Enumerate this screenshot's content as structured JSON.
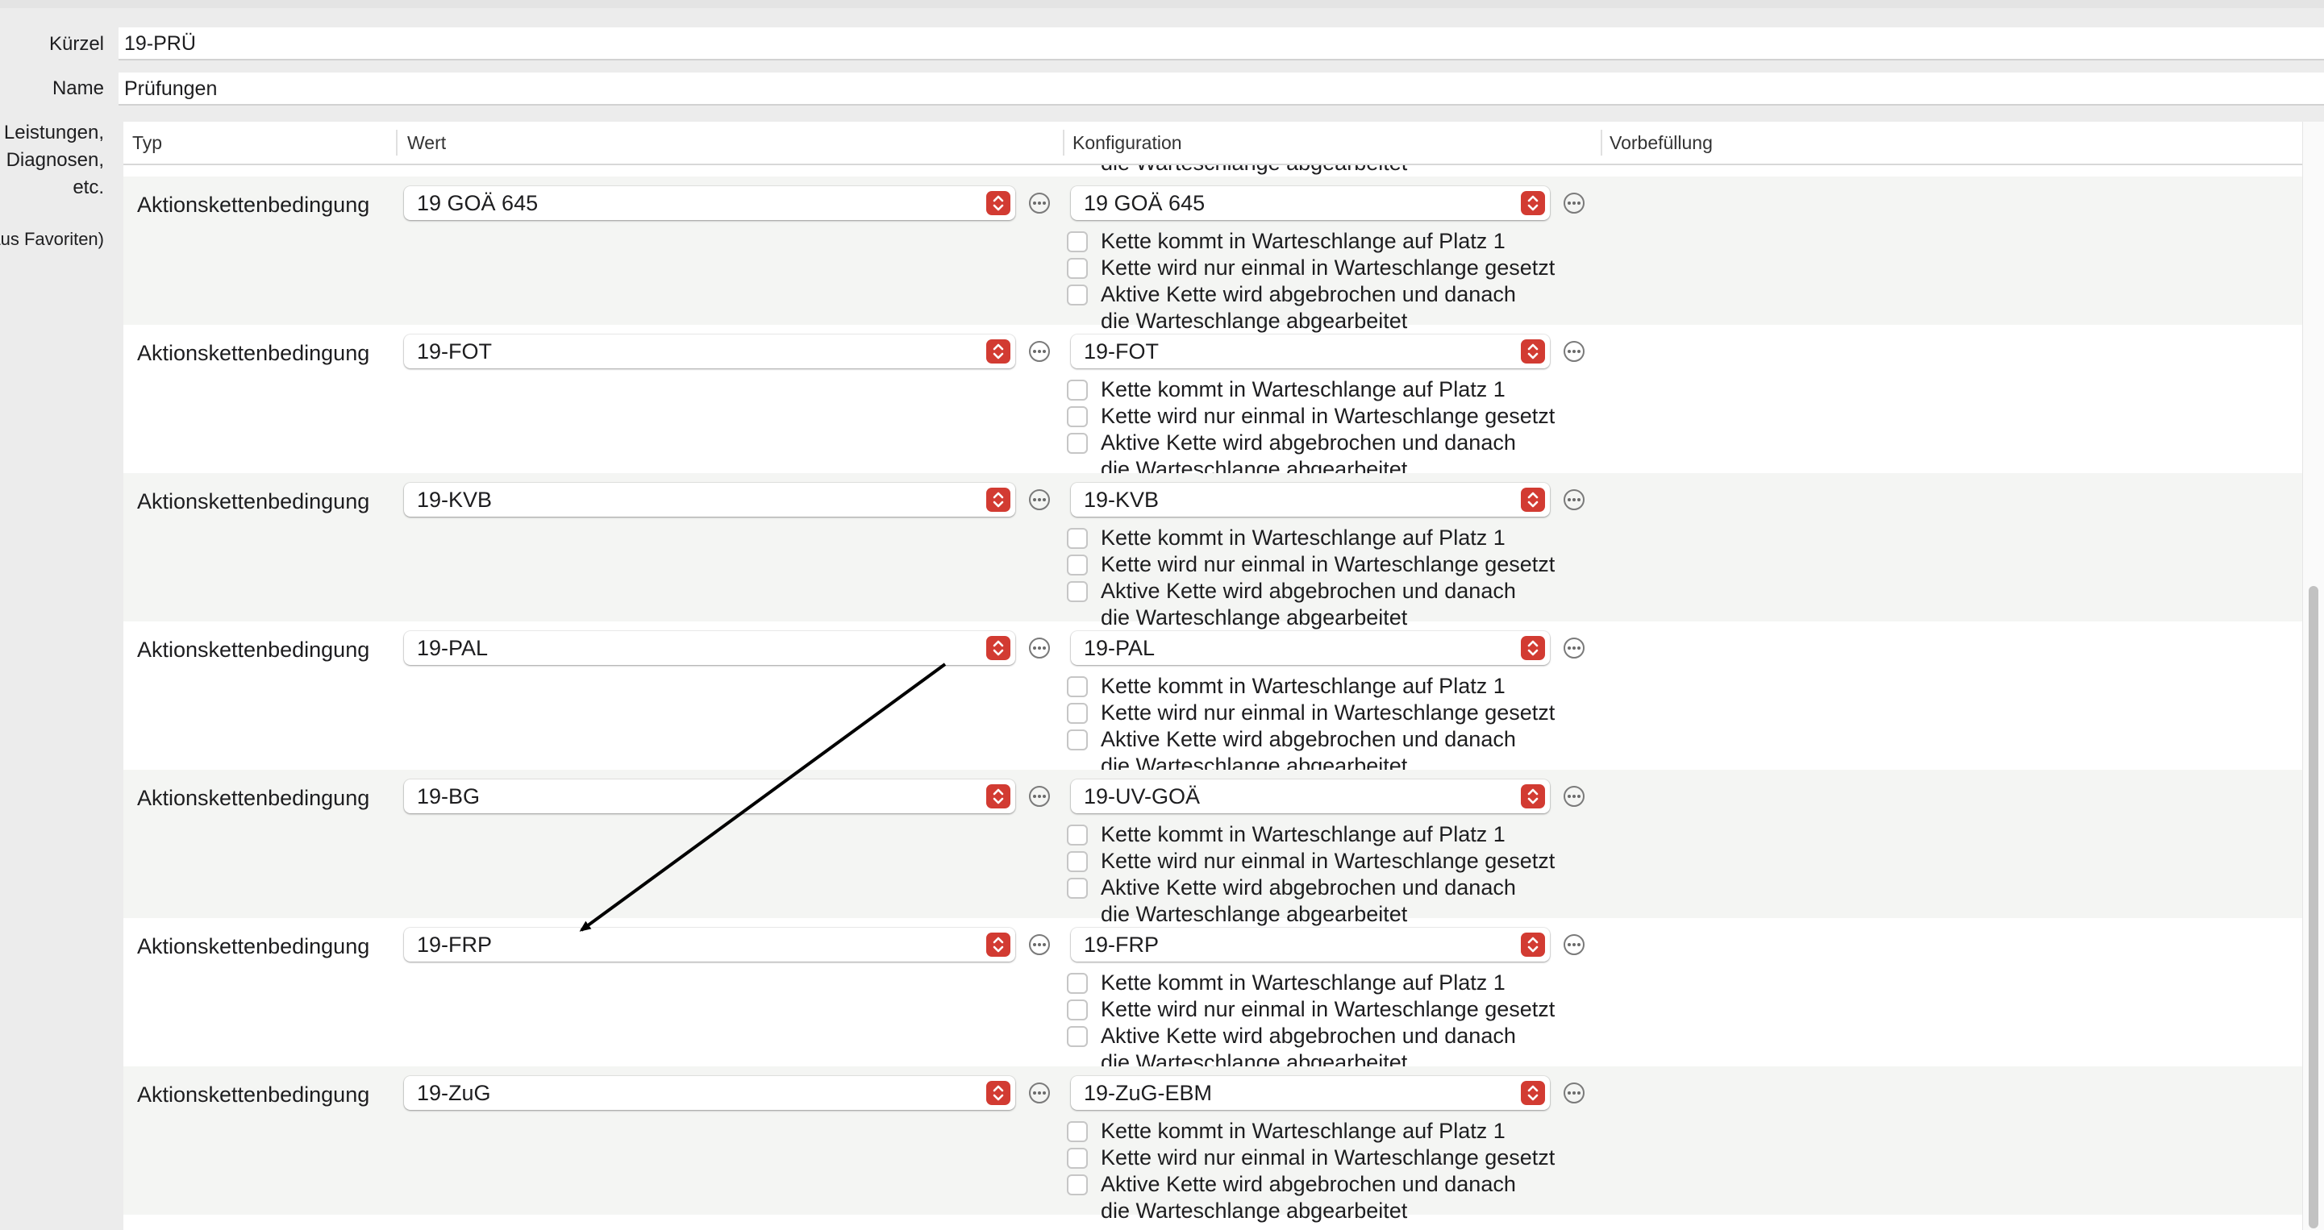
{
  "form": {
    "kuerzel_label": "Kürzel",
    "kuerzel_value": "19-PRÜ",
    "name_label": "Name",
    "name_value": "Prüfungen",
    "side_lines": [
      "Leistungen,",
      "Diagnosen,",
      "etc."
    ],
    "side_favoriten": "(aus Favoriten)"
  },
  "table": {
    "headers": [
      "Typ",
      "Wert",
      "Konfiguration",
      "Vorbefüllung"
    ],
    "partial_top_line": "die Warteschlange abgearbeitet",
    "option_labels": [
      "Kette kommt in Warteschlange auf Platz 1",
      "Kette wird nur einmal in Warteschlange gesetzt",
      "Aktive Kette wird abgebrochen und danach"
    ],
    "option_continuation": "die Warteschlange abgearbeitet",
    "rows": [
      {
        "typ": "Aktionskettenbedingung",
        "wert": "19 GOÄ 645",
        "konfiguration": "19 GOÄ 645"
      },
      {
        "typ": "Aktionskettenbedingung",
        "wert": "19-FOT",
        "konfiguration": "19-FOT"
      },
      {
        "typ": "Aktionskettenbedingung",
        "wert": "19-KVB",
        "konfiguration": "19-KVB"
      },
      {
        "typ": "Aktionskettenbedingung",
        "wert": "19-PAL",
        "konfiguration": "19-PAL"
      },
      {
        "typ": "Aktionskettenbedingung",
        "wert": "19-BG",
        "konfiguration": "19-UV-GOÄ"
      },
      {
        "typ": "Aktionskettenbedingung",
        "wert": "19-FRP",
        "konfiguration": "19-FRP"
      },
      {
        "typ": "Aktionskettenbedingung",
        "wert": "19-ZuG",
        "konfiguration": "19-ZuG-EBM"
      }
    ]
  },
  "colors": {
    "popup_arrow": "#d23b32",
    "alt_row": "#f4f5f3",
    "annotation_arrow": "#000000"
  },
  "icons": [
    "chevron-updown-icon",
    "ellipsis-circle-icon",
    "annotation-arrow"
  ]
}
